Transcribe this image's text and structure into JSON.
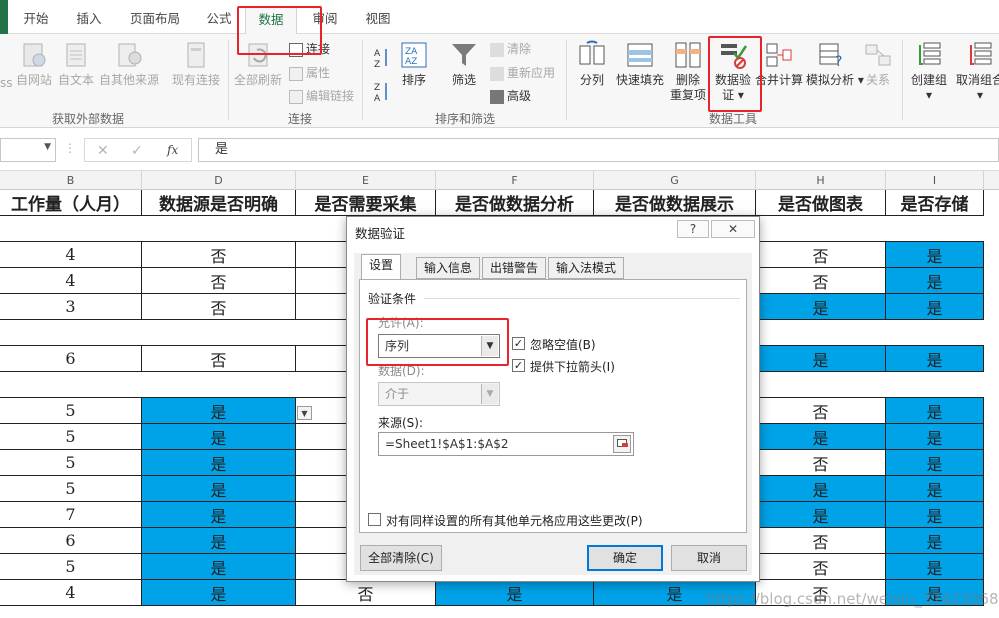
{
  "tabs": [
    "开始",
    "插入",
    "页面布局",
    "公式",
    "数据",
    "审阅",
    "视图"
  ],
  "ribbon": {
    "external_group": {
      "label": "获取外部数据",
      "buttons": [
        "自网站",
        "自文本",
        "自其他来源",
        "现有连接"
      ],
      "cut_prefix": "ss"
    },
    "connections_group": {
      "label": "连接",
      "refresh_all": "全部刷新",
      "items": [
        "连接",
        "属性",
        "编辑链接"
      ]
    },
    "sort_filter_group": {
      "label": "排序和筛选",
      "sort": "排序",
      "filter": "筛选",
      "items": [
        "清除",
        "重新应用",
        "高级"
      ]
    },
    "data_tools_group": {
      "label": "数据工具",
      "split": "分列",
      "flash_fill": "快速填充",
      "remove_dup_1": "删除",
      "remove_dup_2": "重复项",
      "validation_1": "数据验",
      "validation_2": "证",
      "consolidate": "合并计算",
      "whatif": "模拟分析",
      "relations": "关系"
    },
    "outline_group": {
      "group": "创建组",
      "ungroup": "取消组合"
    }
  },
  "formula_bar": {
    "fx": "fx",
    "value": "是"
  },
  "columns": [
    "B",
    "D",
    "E",
    "F",
    "G",
    "H",
    "I"
  ],
  "header_row": [
    "工作量（人月）",
    "数据源是否明确",
    "是否需要采集",
    "是否做数据分析",
    "是否做数据展示",
    "是否做图表",
    "是否存储"
  ],
  "rows": [
    {
      "B": "",
      "D": "",
      "E": "",
      "F": "",
      "G": "",
      "H": "",
      "I": "",
      "blank": true
    },
    {
      "B": "4",
      "D": "否",
      "H": "否",
      "I": "是",
      "blueD": false,
      "blueH": false
    },
    {
      "B": "4",
      "D": "否",
      "H": "否",
      "I": "是",
      "blueD": false,
      "blueH": false
    },
    {
      "B": "3",
      "D": "否",
      "H": "是",
      "I": "是",
      "blueD": false,
      "blueH": true
    },
    {
      "B": "",
      "D": "",
      "H": "",
      "I": "",
      "blank": true
    },
    {
      "B": "6",
      "D": "否",
      "H": "是",
      "I": "是",
      "blueD": false,
      "blueH": true
    },
    {
      "B": "",
      "D": "",
      "H": "",
      "I": "",
      "blank": true
    },
    {
      "B": "5",
      "D": "是",
      "H": "否",
      "I": "是",
      "blueD": true,
      "blueH": false
    },
    {
      "B": "5",
      "D": "是",
      "H": "是",
      "I": "是",
      "blueD": true,
      "blueH": true
    },
    {
      "B": "5",
      "D": "是",
      "H": "否",
      "I": "是",
      "blueD": true,
      "blueH": false
    },
    {
      "B": "5",
      "D": "是",
      "H": "是",
      "I": "是",
      "blueD": true,
      "blueH": true
    },
    {
      "B": "7",
      "D": "是",
      "H": "是",
      "I": "是",
      "blueD": true,
      "blueH": true
    },
    {
      "B": "6",
      "D": "是",
      "H": "否",
      "I": "是",
      "blueD": true,
      "blueH": false
    },
    {
      "B": "5",
      "D": "是",
      "H": "否",
      "I": "是",
      "blueD": true,
      "blueH": false
    },
    {
      "B": "4",
      "D": "是",
      "E": "否",
      "F": "是",
      "G": "是",
      "H": "否",
      "I": "是",
      "blueD": true,
      "blueH": false
    }
  ],
  "dialog": {
    "title": "数据验证",
    "help": "?",
    "close": "✕",
    "tabs": [
      "设置",
      "输入信息",
      "出错警告",
      "输入法模式"
    ],
    "section": "验证条件",
    "allow_label": "允许(A):",
    "allow_value": "序列",
    "data_label": "数据(D):",
    "data_value": "介于",
    "ignore_blank": "忽略空值(B)",
    "dropdown": "提供下拉箭头(I)",
    "source_label": "来源(S):",
    "source_value": "=Sheet1!$A$1:$A$2",
    "apply_all": "对有同样设置的所有其他单元格应用这些更改(P)",
    "clear_all": "全部清除(C)",
    "ok": "确定",
    "cancel": "取消"
  },
  "watermark": "https://blog.csdn.net/weixin_37423068",
  "colors": {
    "excel_green": "#217346",
    "cell_blue": "#00a2e8",
    "highlight_red": "#e8232c"
  }
}
